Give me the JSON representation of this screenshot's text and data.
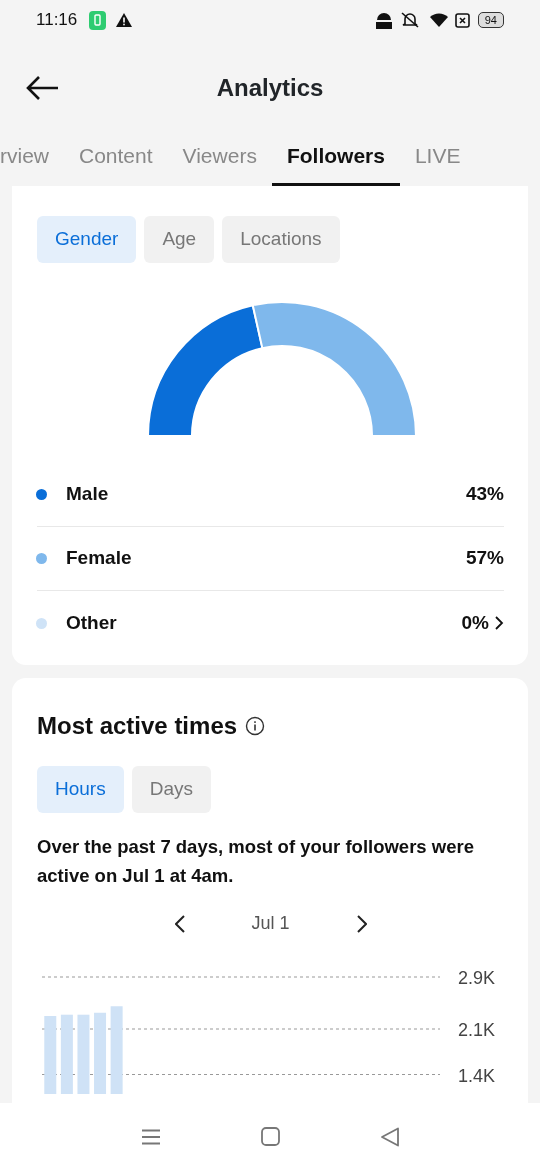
{
  "status_bar": {
    "time": "11:16",
    "battery": "94"
  },
  "header": {
    "title": "Analytics"
  },
  "tabs": [
    {
      "label": "rview",
      "selected": false
    },
    {
      "label": "Content",
      "selected": false
    },
    {
      "label": "Viewers",
      "selected": false
    },
    {
      "label": "Followers",
      "selected": true
    },
    {
      "label": "LIVE",
      "selected": false
    }
  ],
  "gender_card": {
    "filters": [
      {
        "label": "Gender",
        "selected": true
      },
      {
        "label": "Age",
        "selected": false
      },
      {
        "label": "Locations",
        "selected": false
      }
    ],
    "chart_data": {
      "type": "donut",
      "categories": [
        "Male",
        "Female",
        "Other"
      ],
      "values": [
        43,
        57,
        0
      ]
    },
    "legend": [
      {
        "value": "43%",
        "color": "#0a6ed8",
        "expandable": false
      },
      {
        "value": "57%",
        "color": "#7fb8ec",
        "expandable": false
      },
      {
        "value": "0%",
        "color": "#cfe3f7",
        "expandable": true
      }
    ]
  },
  "active_card": {
    "title": "Most active times",
    "filters": [
      {
        "label": "Hours",
        "selected": true
      },
      {
        "label": "Days",
        "selected": false
      }
    ],
    "summary": "Over the past 7 days, most of your followers were active on Jul 1 at 4am.",
    "date": "Jul 1",
    "chart_data": {
      "type": "bar",
      "ylim": [
        1100,
        2900
      ],
      "yticks": [
        {
          "value": 2900,
          "label": "2.9K"
        },
        {
          "value": 2100,
          "label": "2.1K"
        },
        {
          "value": 1400,
          "label": "1.4K"
        }
      ],
      "values": [
        2300,
        2320,
        2320,
        2350,
        2450,
        null,
        null,
        null,
        null,
        null,
        null,
        null,
        null,
        null,
        null,
        null,
        null,
        null,
        null,
        null,
        null,
        null,
        null,
        null
      ]
    }
  }
}
